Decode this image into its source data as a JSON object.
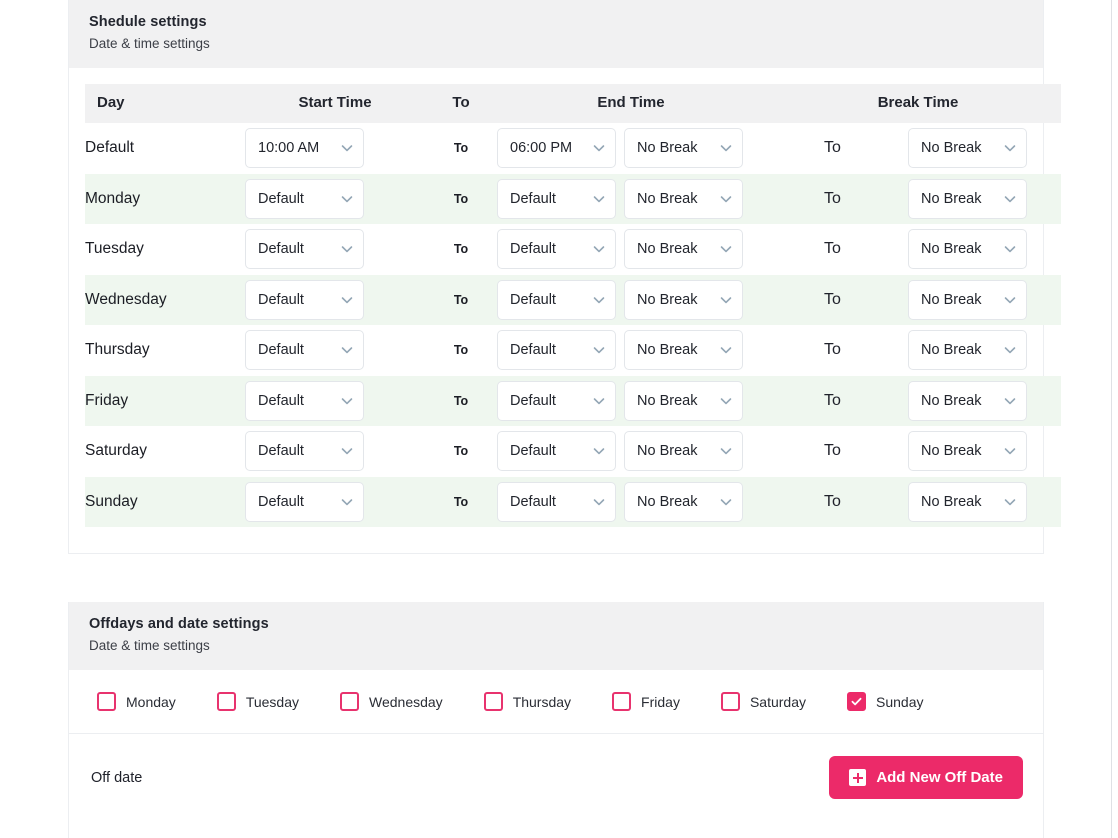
{
  "schedule": {
    "title": "Shedule settings",
    "subtitle": "Date & time settings",
    "columns": {
      "day": "Day",
      "start_time": "Start Time",
      "to": "To",
      "end_time": "End Time",
      "break_time": "Break Time"
    },
    "to_label": "To",
    "rows": [
      {
        "day": "Default",
        "start": "10:00 AM",
        "end": "06:00 PM",
        "break_start": "No Break",
        "break_end": "No Break"
      },
      {
        "day": "Monday",
        "start": "Default",
        "end": "Default",
        "break_start": "No Break",
        "break_end": "No Break"
      },
      {
        "day": "Tuesday",
        "start": "Default",
        "end": "Default",
        "break_start": "No Break",
        "break_end": "No Break"
      },
      {
        "day": "Wednesday",
        "start": "Default",
        "end": "Default",
        "break_start": "No Break",
        "break_end": "No Break"
      },
      {
        "day": "Thursday",
        "start": "Default",
        "end": "Default",
        "break_start": "No Break",
        "break_end": "No Break"
      },
      {
        "day": "Friday",
        "start": "Default",
        "end": "Default",
        "break_start": "No Break",
        "break_end": "No Break"
      },
      {
        "day": "Saturday",
        "start": "Default",
        "end": "Default",
        "break_start": "No Break",
        "break_end": "No Break"
      },
      {
        "day": "Sunday",
        "start": "Default",
        "end": "Default",
        "break_start": "No Break",
        "break_end": "No Break"
      }
    ]
  },
  "offdays": {
    "title": "Offdays and date settings",
    "subtitle": "Date & time settings",
    "checkboxes": [
      {
        "label": "Monday",
        "checked": false
      },
      {
        "label": "Tuesday",
        "checked": false
      },
      {
        "label": "Wednesday",
        "checked": false
      },
      {
        "label": "Thursday",
        "checked": false
      },
      {
        "label": "Friday",
        "checked": false
      },
      {
        "label": "Saturday",
        "checked": false
      },
      {
        "label": "Sunday",
        "checked": true
      }
    ],
    "offdate_label": "Off date",
    "add_button_label": "Add New Off Date"
  },
  "colors": {
    "accent_pink": "#ec2a69",
    "header_gray": "#f1f1f2",
    "row_alt_green": "#eff7ef",
    "border": "#eceef1"
  }
}
